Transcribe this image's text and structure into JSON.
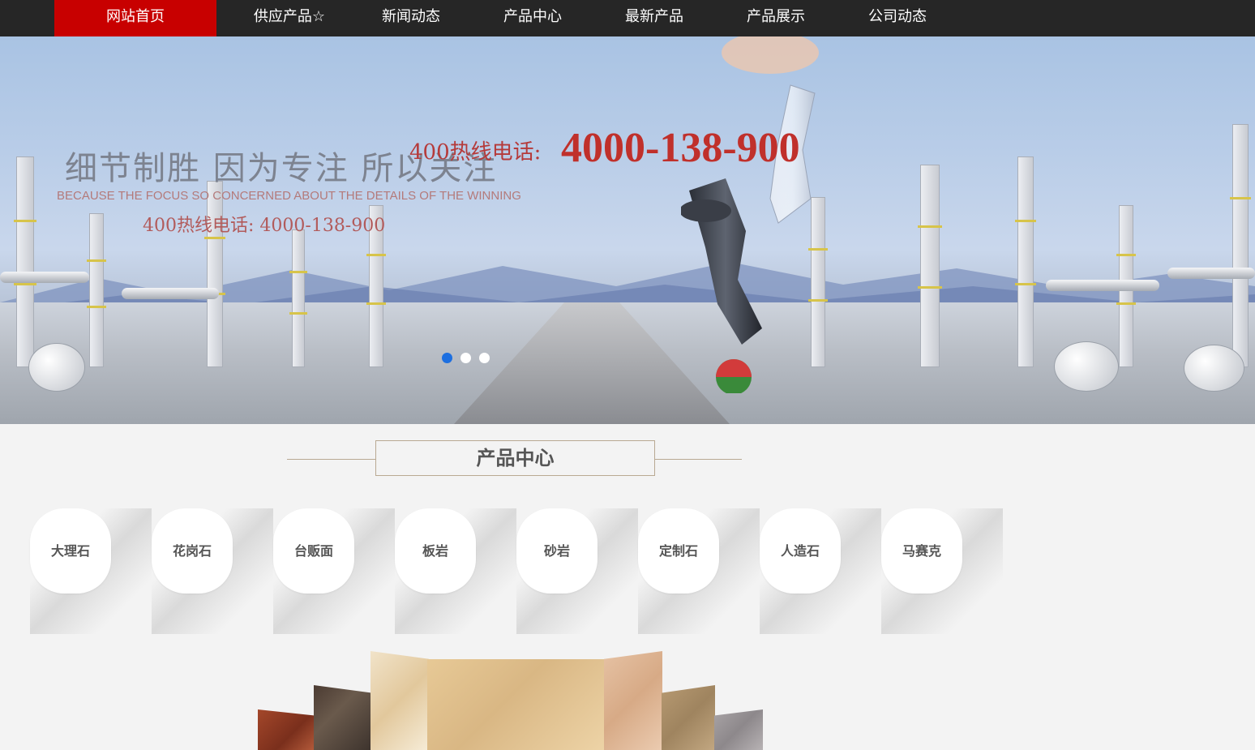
{
  "nav": {
    "items": [
      {
        "label": "网站首页",
        "active": true
      },
      {
        "label": "供应产品☆",
        "active": false
      },
      {
        "label": "新闻动态",
        "active": false
      },
      {
        "label": "产品中心",
        "active": false
      },
      {
        "label": "最新产品",
        "active": false
      },
      {
        "label": "产品展示",
        "active": false
      },
      {
        "label": "公司动态",
        "active": false
      }
    ]
  },
  "banner": {
    "headline_cn": "细节制胜  因为专注  所以关注",
    "headline_en": "BECAUSE THE FOCUS SO CONCERNED ABOUT THE DETAILS OF THE WINNING",
    "headline_sub": "400热线电话: 4000-138-900",
    "hotline_label": "400热线电话:",
    "hotline_number": "4000-138-900",
    "slides": 3,
    "active_slide": 1
  },
  "products_section": {
    "title": "产品中心",
    "categories": [
      "大理石",
      "花岗石",
      "台贩面",
      "板岩",
      "砂岩",
      "定制石",
      "人造石",
      "马赛克"
    ]
  },
  "colors": {
    "nav_bg": "#262626",
    "nav_active": "#c80000",
    "hotline_red": "#c0302b",
    "dot_active": "#1d6fe0"
  }
}
